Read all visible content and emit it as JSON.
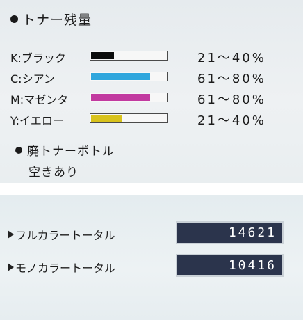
{
  "toner_section": {
    "title": "トナー残量",
    "items": [
      {
        "label": "K:ブラック",
        "range": "21～40%",
        "level": 0.3,
        "color": "#0c0c0c"
      },
      {
        "label": "C:シアン",
        "range": "61～80%",
        "level": 0.78,
        "color": "#2fa6dd"
      },
      {
        "label": "M:マゼンタ",
        "range": "61～80%",
        "level": 0.78,
        "color": "#c23aa0"
      },
      {
        "label": "Y:イエロー",
        "range": "21～40%",
        "level": 0.4,
        "color": "#d8c21c"
      }
    ]
  },
  "waste_section": {
    "title": "廃トナーボトル",
    "status": "空きあり"
  },
  "counters": [
    {
      "label": "フルカラートータル",
      "value": "14621"
    },
    {
      "label": "モノカラートータル",
      "value": "10416"
    }
  ]
}
